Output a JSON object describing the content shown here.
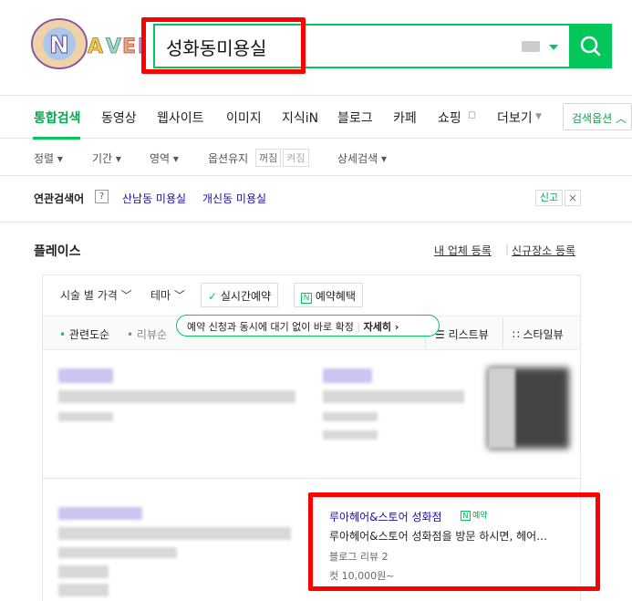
{
  "header": {
    "logo_text": "NAVER",
    "search_value": "성화동미용실",
    "accent": "#03c75a",
    "highlight": "#ff0000"
  },
  "tabs": [
    {
      "label": "통합검색",
      "active": true
    },
    {
      "label": "동영상"
    },
    {
      "label": "웹사이트"
    },
    {
      "label": "이미지"
    },
    {
      "label": "지식iN"
    },
    {
      "label": "블로그"
    },
    {
      "label": "카페"
    },
    {
      "label": "쇼핑"
    },
    {
      "label": "더보기"
    }
  ],
  "search_options_label": "검색옵션",
  "filters": {
    "sort": "정렬",
    "period": "기간",
    "area": "영역",
    "keep_option": "옵션유지",
    "on": "꺼짐",
    "off": "켜짐",
    "detail": "상세검색"
  },
  "related": {
    "title": "연관검색어",
    "help": "?",
    "items": [
      "산남동 미용실",
      "개신동 미용실"
    ],
    "report": "신고",
    "close": "×"
  },
  "place": {
    "title": "플레이스",
    "links": [
      "내 업체 등록",
      "신규장소 등록"
    ],
    "filters": [
      "시술 별 가격",
      "테마",
      "실시간예약",
      "예약혜택"
    ],
    "sub": [
      "관련도순",
      "리뷰순"
    ],
    "tooltip": "예약 신청과 동시에 대기 없이 바로 확정",
    "tooltip_more": "자세히",
    "views": [
      "리스트뷰",
      "스타일뷰"
    ]
  },
  "result": {
    "name": "루아헤어&스토어 성화점",
    "badge": "예약",
    "badge_icon": "N",
    "desc": "루아헤어&스토어 성화점을 방문 하시면, 헤어…",
    "reviews": "블로그 리뷰 2",
    "price": "컷 10,000원~"
  }
}
